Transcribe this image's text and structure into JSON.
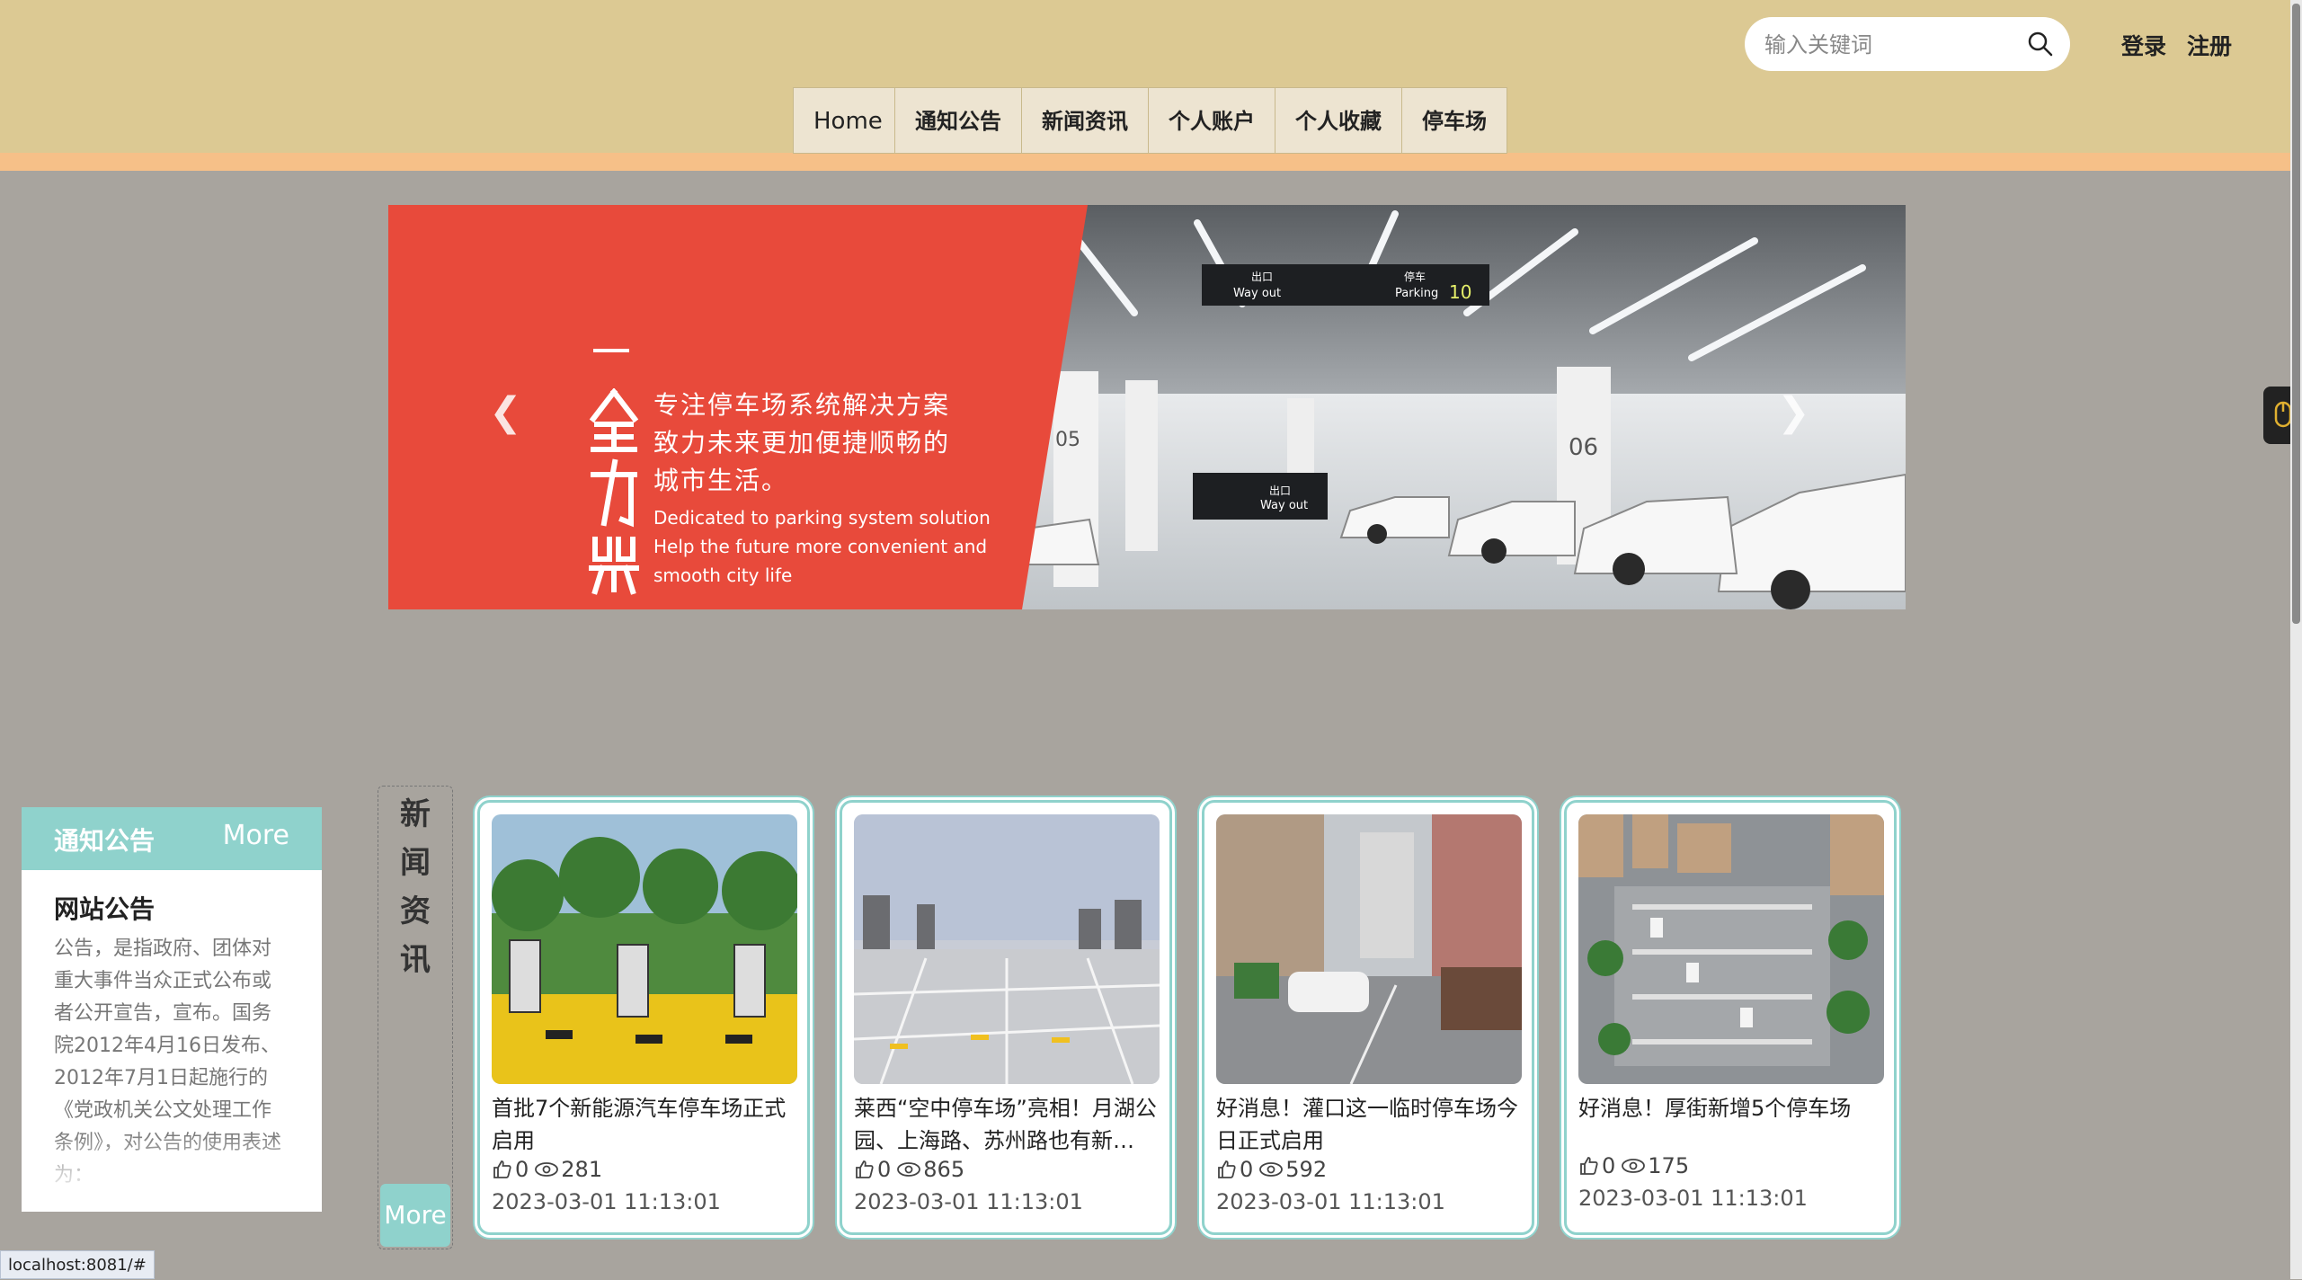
{
  "search": {
    "placeholder": "输入关键词"
  },
  "auth": {
    "login": "登录",
    "register": "注册"
  },
  "nav": [
    "Home",
    "通知公告",
    "新闻资讯",
    "个人账户",
    "个人收藏",
    "停车场"
  ],
  "banner": {
    "cn_lines": [
      "专注停车场系统解决方案",
      "致力未来更加便捷顺畅的",
      "城市生活。"
    ],
    "en_lines": [
      "Dedicated to parking system solution",
      "Help the future more convenient and",
      "smooth city life"
    ],
    "sign_exit_cn": "出口",
    "sign_exit_en": "Way out",
    "sign_parking_cn": "停车",
    "sign_parking_en": "Parking",
    "sign_parking_count": "10",
    "pillar_labels": [
      "05",
      "06"
    ]
  },
  "notice": {
    "header": "通知公告",
    "more": "More",
    "title": "网站公告",
    "body": "公告，是指政府、团体对重大事件当众正式公布或者公开宣告，宣布。国务院2012年4月16日发布、2012年7月1日起施行的《党政机关公文处理工作条例》，对公告的使用表述为："
  },
  "news": {
    "side_title": [
      "新",
      "闻",
      "资",
      "讯"
    ],
    "more": "More",
    "cards": [
      {
        "title": "首批7个新能源汽车停车场正式启用",
        "likes": "0",
        "views": "281",
        "date": "2023-03-01 11:13:01"
      },
      {
        "title": "莱西“空中停车场”亮相！月湖公园、上海路、苏州路也有新…",
        "likes": "0",
        "views": "865",
        "date": "2023-03-01 11:13:01"
      },
      {
        "title": "好消息！灌口这一临时停车场今日正式启用",
        "likes": "0",
        "views": "592",
        "date": "2023-03-01 11:13:01"
      },
      {
        "title": "好消息！厚街新增5个停车场",
        "likes": "0",
        "views": "175",
        "date": "2023-03-01 11:13:01"
      }
    ]
  },
  "status_url": "localhost:8081/#",
  "colors": {
    "header": "#dcc993",
    "accent": "#8fd2cc",
    "banner_red": "#e84a3b",
    "page_bg": "#a8a49e"
  }
}
